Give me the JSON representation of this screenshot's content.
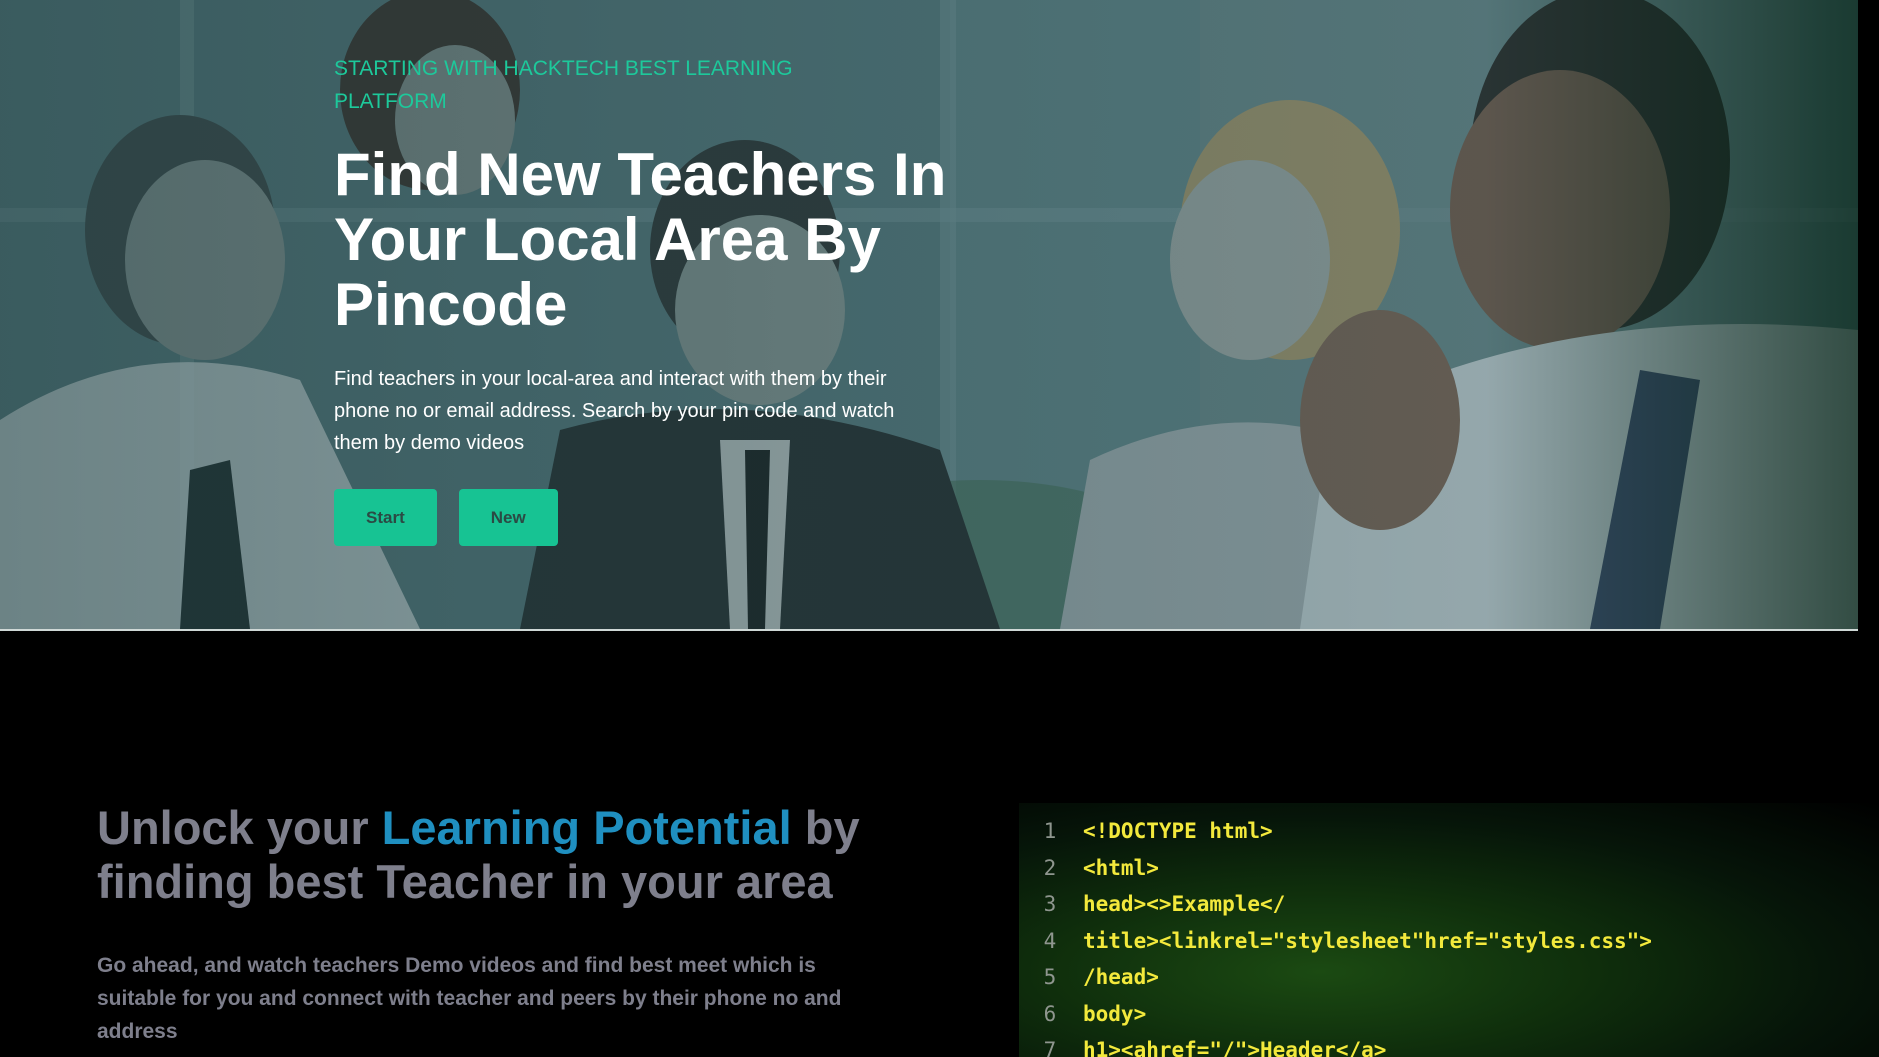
{
  "hero": {
    "eyebrow": "STARTING WITH HACKTECH BEST LEARNING PLATFORM",
    "title": "Find New Teachers In Your Local Area By Pincode",
    "description": "Find teachers in your local-area and interact with them by their phone no or email address. Search by your pin code and watch them by demo videos",
    "buttons": {
      "start": "Start",
      "new": "New"
    }
  },
  "section2": {
    "heading_pre": "Unlock your ",
    "heading_accent": "Learning Potential",
    "heading_post": " by finding best Teacher in your area",
    "description": "Go ahead, and watch teachers Demo videos and find best meet which is suitable for you and connect with teacher and peers by their phone no and address"
  },
  "code_block": {
    "lines": [
      {
        "n": "1",
        "text": "<!DOCTYPE html>"
      },
      {
        "n": "2",
        "text": "<html>"
      },
      {
        "n": "3",
        "text": "head><>Example</"
      },
      {
        "n": "4",
        "text": "title><linkrel=\"stylesheet\"href=\"styles.css\">"
      },
      {
        "n": "5",
        "text": "/head>"
      },
      {
        "n": "6",
        "text": "body>"
      },
      {
        "n": "7",
        "text": "h1><ahref=\"/\">Header</a>"
      }
    ]
  },
  "colors": {
    "accent_green": "#17c393",
    "eyebrow_green": "#1dc99b",
    "accent_blue": "#1f8fc0",
    "muted_text": "#7e7f8c",
    "code_yellow": "#f3e93c"
  }
}
